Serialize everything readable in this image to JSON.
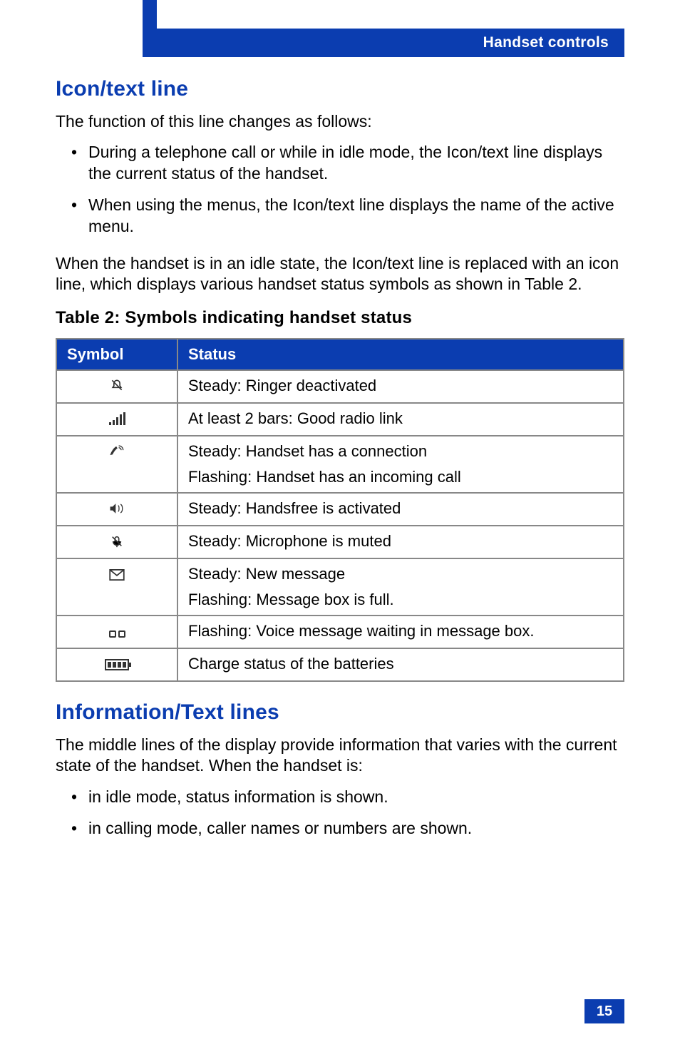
{
  "header": {
    "section": "Handset controls"
  },
  "page_number": "15",
  "section1": {
    "title": "Icon/text line",
    "intro": "The function of this line changes as follows:",
    "bullets": [
      "During a telephone call or while in idle mode, the Icon/text line displays the current status of the handset.",
      "When using the menus, the Icon/text line displays the name of the active menu."
    ],
    "para2": "When the handset is in an idle state, the Icon/text line is replaced with an icon line, which displays various handset status symbols as shown in Table 2."
  },
  "table": {
    "title": "Table 2: Symbols indicating handset status",
    "headers": {
      "symbol": "Symbol",
      "status": "Status"
    },
    "rows": [
      {
        "icon": "ringer-off-icon",
        "status_lines": [
          "Steady: Ringer deactivated"
        ]
      },
      {
        "icon": "signal-bars-icon",
        "status_lines": [
          "At least 2 bars: Good radio link"
        ]
      },
      {
        "icon": "handset-connection-icon",
        "status_lines": [
          "Steady: Handset has a connection",
          "Flashing: Handset has an incoming call"
        ]
      },
      {
        "icon": "handsfree-icon",
        "status_lines": [
          "Steady: Handsfree is activated"
        ]
      },
      {
        "icon": "mic-muted-icon",
        "status_lines": [
          "Steady: Microphone is muted"
        ]
      },
      {
        "icon": "envelope-icon",
        "status_lines": [
          "Steady: New message",
          "Flashing: Message box is full."
        ]
      },
      {
        "icon": "voicemail-tape-icon",
        "status_lines": [
          "Flashing: Voice message waiting in message box."
        ]
      },
      {
        "icon": "battery-icon",
        "status_lines": [
          "Charge status of the batteries"
        ]
      }
    ]
  },
  "section2": {
    "title": "Information/Text lines",
    "intro": "The middle lines of the display provide information that varies with the current state of the handset. When the handset is:",
    "bullets": [
      "in idle mode, status information is shown.",
      "in calling mode, caller names or numbers are shown."
    ]
  }
}
